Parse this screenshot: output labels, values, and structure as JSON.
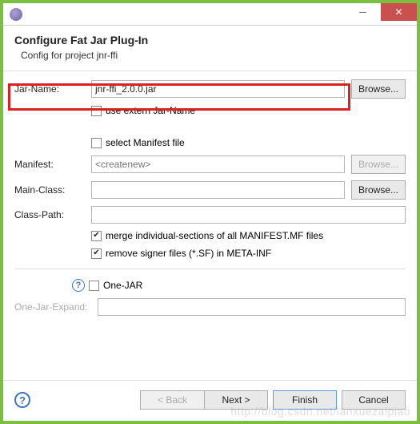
{
  "titlebar": {
    "title": ""
  },
  "header": {
    "title": "Configure Fat Jar Plug-In",
    "subtitle": "Config for project jnr-ffi"
  },
  "fields": {
    "jarName": {
      "label": "Jar-Name:",
      "value": "jnr-ffi_2.0.0.jar",
      "browse": "Browse..."
    },
    "useExtern": {
      "label": "use extern Jar-Name",
      "checked": false
    },
    "selectManifest": {
      "label": "select Manifest file",
      "checked": false
    },
    "manifest": {
      "label": "Manifest:",
      "placeholder": "<createnew>",
      "browse": "Browse..."
    },
    "mainClass": {
      "label": "Main-Class:",
      "value": "",
      "browse": "Browse..."
    },
    "classPath": {
      "label": "Class-Path:",
      "value": ""
    },
    "mergeSections": {
      "label": "merge individual-sections of all MANIFEST.MF files",
      "checked": true
    },
    "removeSigner": {
      "label": "remove signer files (*.SF) in META-INF",
      "checked": true
    },
    "oneJar": {
      "label": "One-JAR",
      "checked": false
    },
    "oneJarExpand": {
      "label": "One-Jar-Expand:",
      "value": ""
    }
  },
  "footer": {
    "back": "< Back",
    "next": "Next >",
    "finish": "Finish",
    "cancel": "Cancel"
  },
  "watermark": "http://blog.csdn.net/lanxuezaipiao"
}
